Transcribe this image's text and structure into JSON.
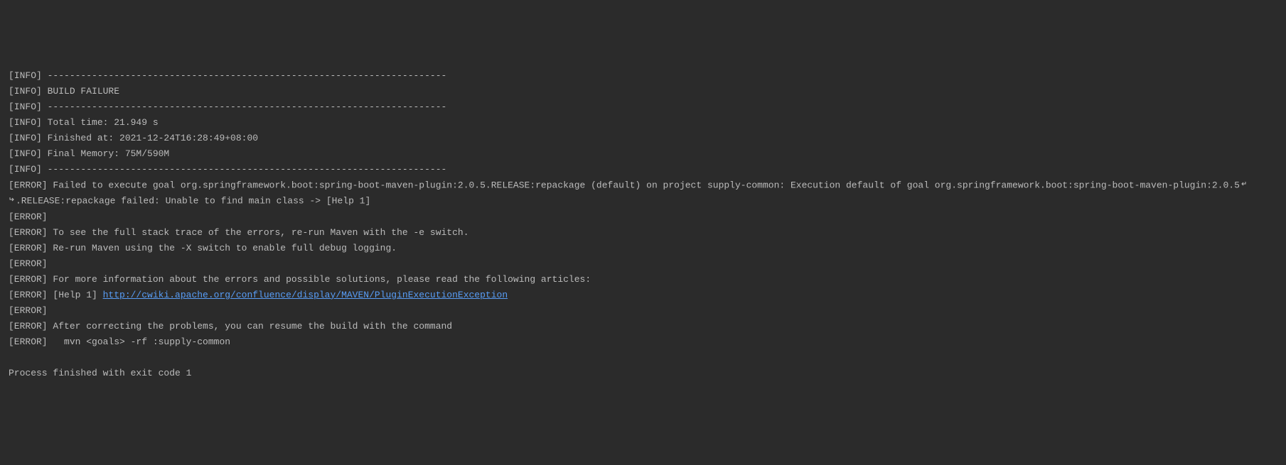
{
  "console": {
    "lines": [
      "[INFO] ------------------------------------------------------------------------",
      "[INFO] BUILD FAILURE",
      "[INFO] ------------------------------------------------------------------------",
      "[INFO] Total time: 21.949 s",
      "[INFO] Finished at: 2021-12-24T16:28:49+08:00",
      "[INFO] Final Memory: 75M/590M",
      "[INFO] ------------------------------------------------------------------------"
    ],
    "error_line_1_prefix": "[ERROR] Failed to execute goal org.springframework.boot:spring-boot-maven-plugin:2.0.5.RELEASE:repackage (default) on project supply-common: Execution default of goal org.springframework.boot:spring-boot-maven-plugin:2.0.5",
    "error_line_1_wrap": ".RELEASE:repackage failed: Unable to find main class -> [Help 1]",
    "error_lines_2": [
      "[ERROR]",
      "[ERROR] To see the full stack trace of the errors, re-run Maven with the -e switch.",
      "[ERROR] Re-run Maven using the -X switch to enable full debug logging.",
      "[ERROR]",
      "[ERROR] For more information about the errors and possible solutions, please read the following articles:"
    ],
    "help_prefix": "[ERROR] [Help 1] ",
    "help_link": "http://cwiki.apache.org/confluence/display/MAVEN/PluginExecutionException",
    "error_lines_3": [
      "[ERROR]",
      "[ERROR] After correcting the problems, you can resume the build with the command",
      "[ERROR]   mvn <goals> -rf :supply-common"
    ],
    "exit_line": "Process finished with exit code 1"
  }
}
